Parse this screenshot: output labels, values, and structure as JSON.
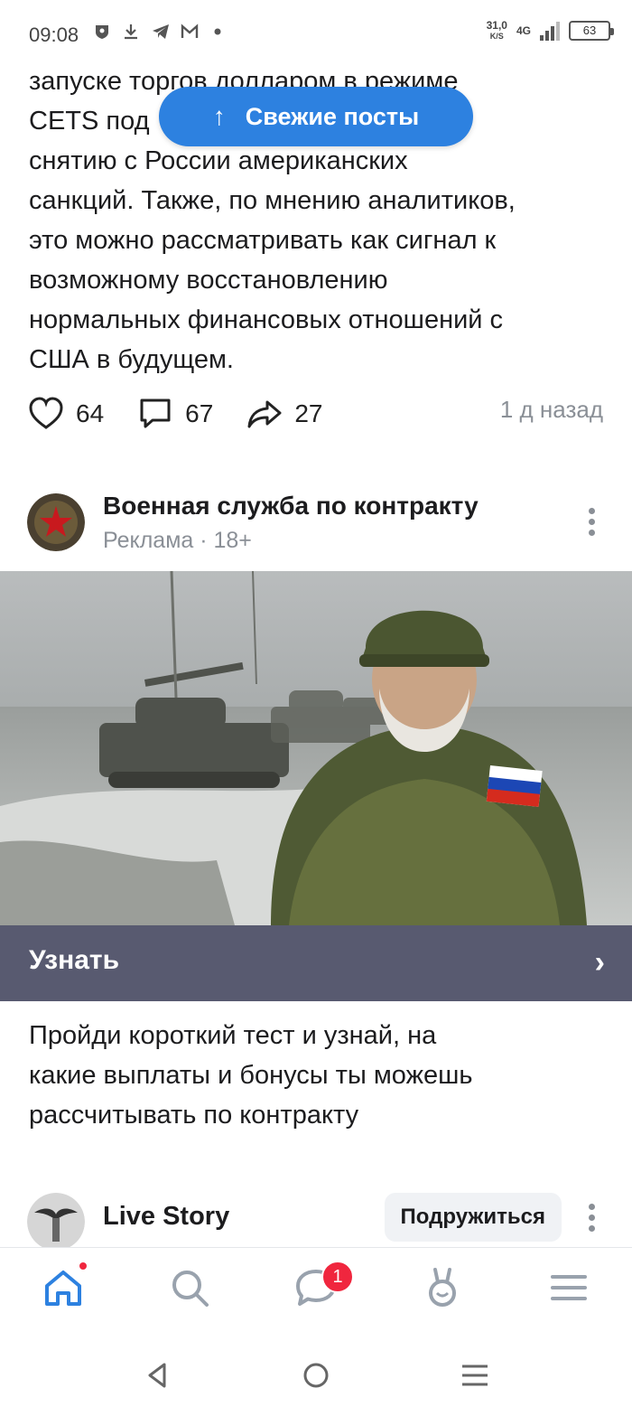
{
  "status_bar": {
    "time": "09:08",
    "speed_value": "31,0",
    "speed_unit": "K/S",
    "network": "4G",
    "battery": "63",
    "left_icons": [
      "shield-icon",
      "download-icon",
      "telegram-icon",
      "gmail-icon",
      "dot-icon"
    ]
  },
  "post": {
    "lines": [
      "запуске торгов долларом в режиме",
      "CETS под                                    му",
      "снятию с России американских",
      "санкций. Также, по мнению аналитиков,",
      "это можно рассматривать как сигнал к",
      "возможному восстановлению",
      "нормальных финансовых отношений с",
      "США в будущем."
    ],
    "likes": "64",
    "comments": "67",
    "shares": "27",
    "time_ago": "1 д назад"
  },
  "fresh_posts": {
    "label": "Свежие посты"
  },
  "ad": {
    "title": "Военная служба по контракту",
    "subtitle": "Реклама · 18+",
    "cta_label": "Узнать",
    "description_lines": [
      "Пройди короткий тест и узнай, на",
      "какие выплаты и бонусы ты можешь",
      "рассчитывать по контракту"
    ]
  },
  "next_post": {
    "author": "Live Story",
    "add_friend_label": "Подружиться"
  },
  "bottom_nav": {
    "messages_badge": "1",
    "items": [
      "home-icon",
      "search-icon",
      "messages-icon",
      "clips-icon",
      "menu-icon"
    ]
  },
  "colors": {
    "accent": "#2d81e0",
    "cta_bar": "#585a70",
    "badge": "#f0263e",
    "muted": "#8a8f96"
  }
}
